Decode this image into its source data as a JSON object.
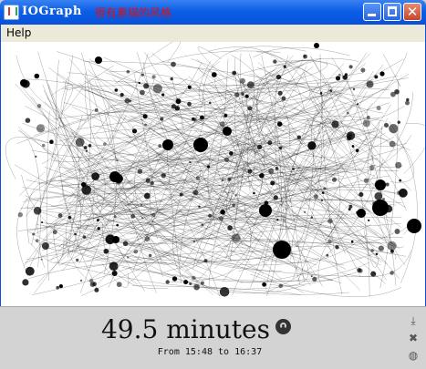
{
  "window": {
    "title": "IOGraph",
    "annotation": "很有素描的风格",
    "minimize_icon": "minimize-icon",
    "maximize_icon": "maximize-icon",
    "close_icon": "close-icon"
  },
  "menu": {
    "items": [
      "Help"
    ]
  },
  "status": {
    "duration": "49.5 minutes",
    "range_prefix": "From",
    "start": "15:48",
    "range_sep": "to",
    "end": "16:37"
  },
  "side_icons": [
    "save-icon",
    "settings-icon",
    "globe-icon"
  ],
  "colors": {
    "titlebar": "#0b5fe6",
    "annotation": "#e01010",
    "canvas": "#ffffff",
    "footer": "#d3d3d3"
  }
}
